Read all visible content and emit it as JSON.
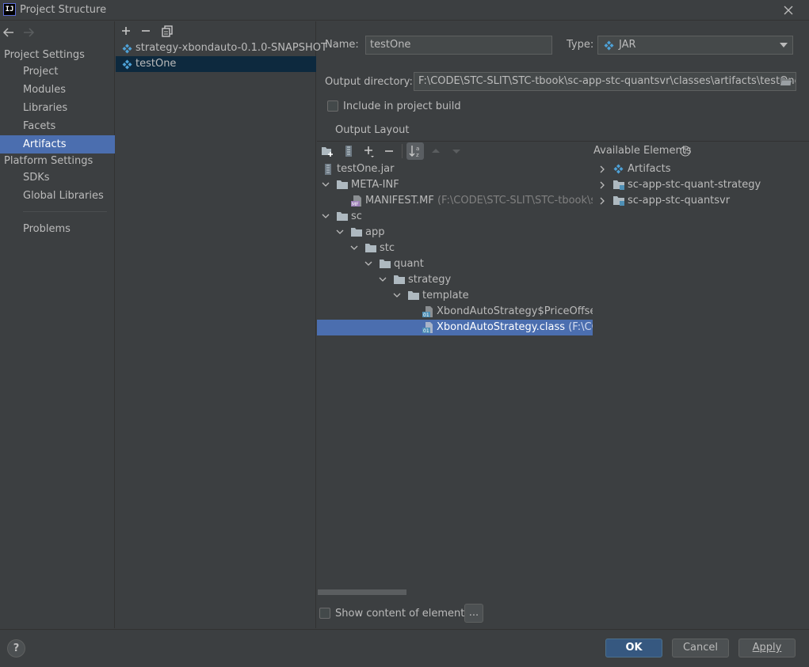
{
  "window": {
    "title": "Project Structure",
    "logo_text": "IJ"
  },
  "nav": {
    "project_settings_label": "Project Settings",
    "project_items": [
      "Project",
      "Modules",
      "Libraries",
      "Facets",
      "Artifacts"
    ],
    "platform_settings_label": "Platform Settings",
    "platform_items": [
      "SDKs",
      "Global Libraries"
    ],
    "problems_label": "Problems",
    "selected": "Artifacts"
  },
  "artifacts_list": {
    "items": [
      "strategy-xbondauto-0.1.0-SNAPSHOT",
      "testOne"
    ],
    "selected": "testOne"
  },
  "form": {
    "name_label": "Name:",
    "name_value": "testOne",
    "type_label": "Type:",
    "type_value": "JAR",
    "output_dir_label": "Output directory:",
    "output_dir_value": "F:\\CODE\\STC-SLIT\\STC-tbook\\sc-app-stc-quantsvr\\classes\\artifacts\\testOne",
    "include_build_label": "Include in project build",
    "include_build_checked": false,
    "output_layout_tab": "Output Layout"
  },
  "output_tree": {
    "jar": "testOne.jar",
    "meta_inf": "META-INF",
    "manifest_name": "MANIFEST.MF",
    "manifest_path": "(F:\\CODE\\STC-SLIT\\STC-tbook\\sc-a",
    "folders": [
      "sc",
      "app",
      "stc",
      "quant",
      "strategy",
      "template"
    ],
    "class1_name": "XbondAutoStrategy$PriceOffsetVa",
    "class2_name": "XbondAutoStrategy.class",
    "class2_path": "(F:\\CODE"
  },
  "available": {
    "label": "Available Elements",
    "items": [
      "Artifacts",
      "sc-app-stc-quant-strategy",
      "sc-app-stc-quantsvr"
    ]
  },
  "show_content_label": "Show content of elements",
  "ellipsis_button": "...",
  "buttons": {
    "ok": "OK",
    "cancel": "Cancel",
    "apply": "Apply",
    "help": "?"
  },
  "colors": {
    "accent": "#4b6eaf",
    "folder": "#aeb9c0",
    "jar_icon": "#4ea2d8"
  }
}
